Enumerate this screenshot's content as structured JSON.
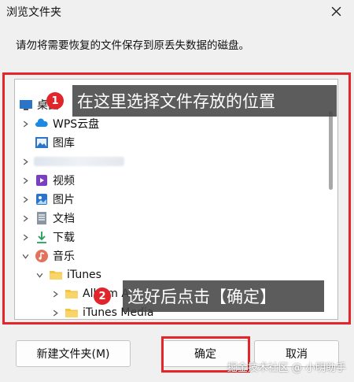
{
  "dialog": {
    "title": "浏览文件夹",
    "instruction": "请勿将需要恢复的文件保存到原丢失数据的磁盘。"
  },
  "tree": {
    "items": [
      {
        "label": "桌面",
        "icon": "desktop-icon",
        "expanded": false
      },
      {
        "label": "WPS云盘",
        "icon": "cloud-icon"
      },
      {
        "label": "图库",
        "icon": "gallery-icon"
      },
      {
        "label": "",
        "icon": "blurred-item-icon"
      },
      {
        "label": "视频",
        "icon": "video-icon"
      },
      {
        "label": "图片",
        "icon": "picture-icon"
      },
      {
        "label": "文档",
        "icon": "document-icon"
      },
      {
        "label": "下载",
        "icon": "download-icon"
      },
      {
        "label": "音乐",
        "icon": "music-icon",
        "expanded": true
      },
      {
        "label": "iTunes",
        "icon": "folder-icon",
        "expanded": true
      },
      {
        "label": "Album A",
        "icon": "folder-icon"
      },
      {
        "label": "iTunes Media",
        "icon": "folder-icon"
      }
    ]
  },
  "annotations": {
    "step1_badge": "1",
    "step1_text": "在这里选择文件存放的位置",
    "step2_badge": "2",
    "step2_text": "选好后点击【确定】"
  },
  "buttons": {
    "new_folder": "新建文件夹(M)",
    "ok": "确定",
    "cancel": "取消"
  },
  "watermark": "掘金技术社区 @ 小明助手",
  "colors": {
    "highlight": "#e4262b",
    "folder": "#f5c242",
    "badge": "#e0262b"
  }
}
